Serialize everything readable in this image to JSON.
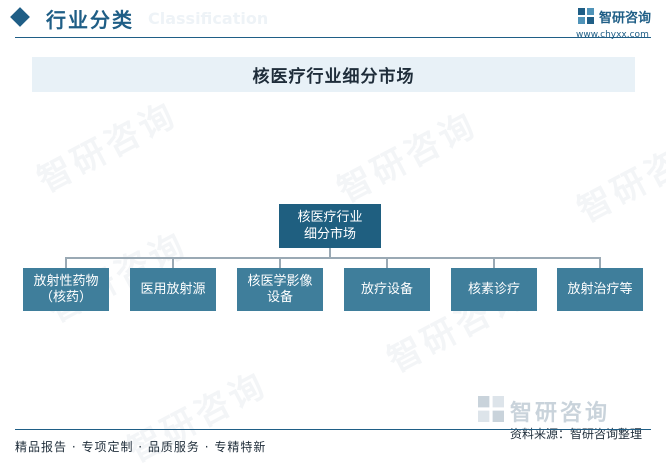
{
  "header": {
    "title": "行业分类",
    "title_en": "Classification",
    "brand_name": "智研咨询",
    "brand_url": "www.chyxx.com"
  },
  "banner": {
    "title": "核医疗行业细分市场"
  },
  "diagram": {
    "root": "核医疗行业细分市场",
    "children": [
      "放射性药物（核药）",
      "医用放射源",
      "核医学影像设备",
      "放疗设备",
      "核素诊疗",
      "放射治疗等"
    ]
  },
  "watermark": {
    "text": "智研咨询"
  },
  "footer": {
    "left": "精品报告 · 专项定制 · 品质服务 · 专精特新",
    "source": "资料来源：智研咨询整理"
  },
  "colors": {
    "primary": "#1f5e86",
    "node": "#3f7e9b",
    "root": "#1f5f80",
    "banner_bg": "#e8f1f7"
  }
}
